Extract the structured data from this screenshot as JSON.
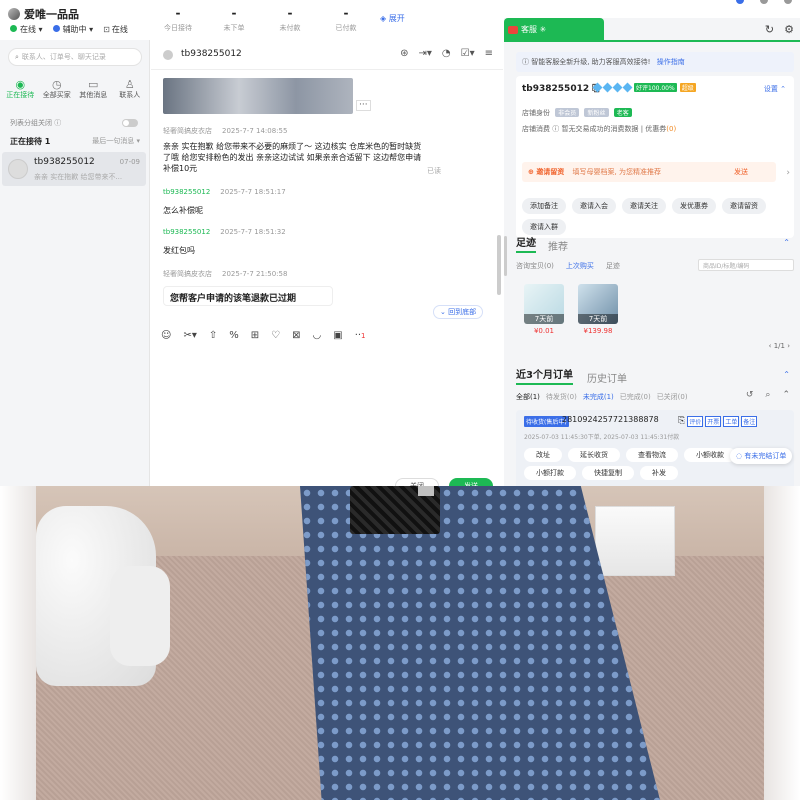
{
  "app": {
    "title": "爱唯一品品",
    "status": {
      "online": "在线",
      "assist": "辅助中",
      "tool_online": "在线"
    }
  },
  "stats": [
    {
      "value": "-",
      "label": "今日接待"
    },
    {
      "value": "-",
      "label": "未下单"
    },
    {
      "value": "-",
      "label": "未付款"
    },
    {
      "value": "-",
      "label": "已付款"
    }
  ],
  "expand_label": "展开",
  "left": {
    "search_placeholder": "联系人、订单号、聊天记录",
    "nav": [
      "正在接待",
      "全部买家",
      "其他消息",
      "联系人"
    ],
    "group_label": "列表分组关闭",
    "serving_label": "正在接待",
    "serving_count": "1",
    "sort_label": "最后一句消息",
    "conversation": {
      "name": "tb938255012",
      "time": "07-09",
      "preview": "亲亲 实在拖歉 给您带来不..."
    }
  },
  "chat": {
    "title": "tb938255012",
    "messages": [
      {
        "sender": "轻奢简搞皮衣店",
        "time": "2025-7-7 14:08:55",
        "text": "亲亲 实在抱歉 给您带来不必要的麻烦了～ 这边核实 仓库米色的暂时缺货了哦 给您安排粉色的发出 亲亲这边试试 如果亲亲合适留下 这边帮您申请补偿10元",
        "status": "已读"
      },
      {
        "sender": "tb938255012",
        "time": "2025-7-7 18:51:17",
        "text": "怎么补偿呢"
      },
      {
        "sender": "tb938255012",
        "time": "2025-7-7 18:51:32",
        "text": "发红包吗"
      },
      {
        "sender": "轻奢简搞皮衣店",
        "time": "2025-7-7 21:50:58",
        "text": "您帮客户申请的该笔退款已过期"
      }
    ],
    "back_to_bottom": "回到底部",
    "toolbar_badge": "1",
    "close_label": "关闭",
    "send_label": "发送"
  },
  "right": {
    "tab_label": "客服",
    "notice": "智能客服全新升级, 助力客服高效接待!",
    "notice_link": "操作指南",
    "customer": {
      "name": "tb938255012",
      "good_rate": "好评100.00%",
      "level": "超级",
      "settings": "设置",
      "identity_label": "店铺身份",
      "identity_tags": [
        "非会员",
        "新粉丝",
        "老客"
      ],
      "spend_label": "店铺消费",
      "spend_text": "暂无交易成功的消费数据",
      "coupon_label": "优惠券",
      "coupon_count": "(0)"
    },
    "invite": {
      "title": "邀请留资",
      "desc": "填写母婴档案, 为您精准推荐",
      "send": "发送"
    },
    "actions": [
      "添加备注",
      "邀请入会",
      "邀请关注",
      "发优惠券",
      "邀请留资",
      "邀请入群"
    ],
    "footprint": {
      "tabs": [
        "足迹",
        "推荐"
      ],
      "sub": [
        "咨询宝贝(0)",
        "上次购买",
        "足迹"
      ],
      "search_placeholder": "商品ID/标题/编码",
      "products": [
        {
          "days": "7天前",
          "price": "¥0.01"
        },
        {
          "days": "7天前",
          "price": "¥139.98"
        }
      ],
      "pager": "1/1"
    },
    "orders": {
      "tabs": [
        "近3个月订单",
        "历史订单"
      ],
      "filters": [
        "全部(1)",
        "待发货(0)",
        "未完成(1)",
        "已完成(0)",
        "已关闭(0)"
      ],
      "status": "待收货(售后中)",
      "order_no": "2810924257721388878",
      "tags": [
        "评价",
        "开票",
        "工单",
        "备注"
      ],
      "time": "2025-07-03 11:45:30下单, 2025-07-03 11:45:31付款",
      "buttons": [
        "改址",
        "延长收货",
        "查看物流",
        "小额收款",
        "小额打款",
        "快捷复制",
        "补发"
      ],
      "unfinished": "有未完结订单"
    }
  }
}
